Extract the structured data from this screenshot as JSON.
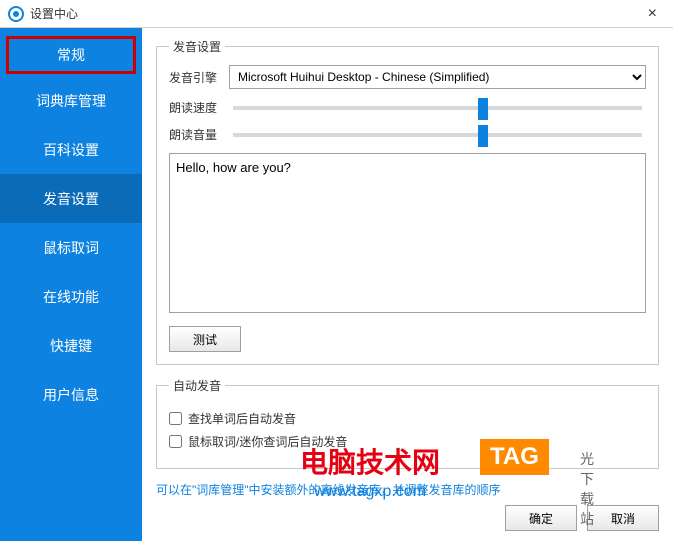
{
  "window": {
    "title": "设置中心",
    "close": "×"
  },
  "sidebar": {
    "items": [
      {
        "label": "常规"
      },
      {
        "label": "词典库管理"
      },
      {
        "label": "百科设置"
      },
      {
        "label": "发音设置"
      },
      {
        "label": "鼠标取词"
      },
      {
        "label": "在线功能"
      },
      {
        "label": "快捷键"
      },
      {
        "label": "用户信息"
      }
    ]
  },
  "pronunciation": {
    "legend": "发音设置",
    "engine_label": "发音引擎",
    "engine_value": "Microsoft Huihui Desktop - Chinese (Simplified)",
    "speed_label": "朗读速度",
    "speed_percent": 60,
    "volume_label": "朗读音量",
    "volume_percent": 60,
    "textarea_value": "Hello, how are you?",
    "test_label": "测试"
  },
  "auto": {
    "legend": "自动发音",
    "cb1_label": "查找单词后自动发音",
    "cb1_checked": false,
    "cb2_label": "鼠标取词/迷你查词后自动发音",
    "cb2_checked": false
  },
  "hint": "可以在\"词库管理\"中安装额外的离线发音库，并调整发音库的顺序",
  "footer": {
    "ok": "确定",
    "cancel": "取消"
  },
  "watermark": {
    "main": "电脑技术网",
    "sub": "www.tagxp.com",
    "tag": "TAG",
    "extra": "光下载站"
  }
}
